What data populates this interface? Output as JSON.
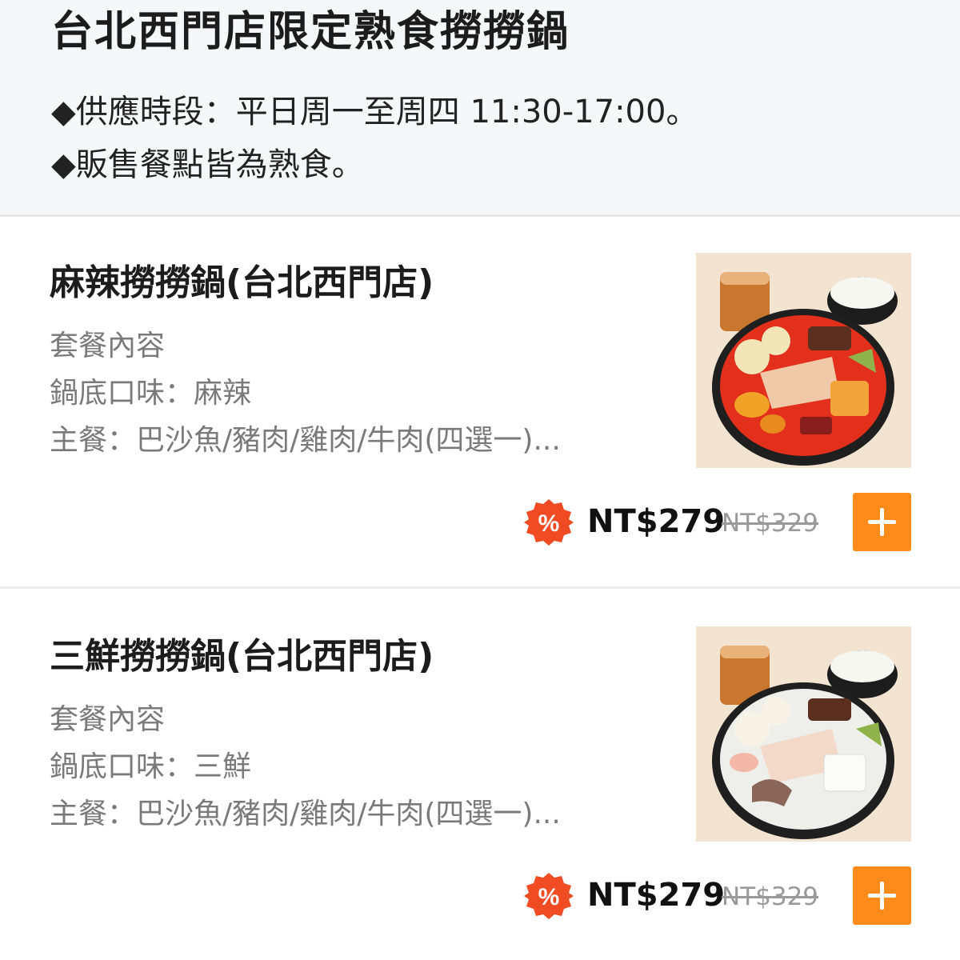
{
  "section": {
    "title": "台北西門店限定熟食撈撈鍋",
    "notices": [
      "◆供應時段：平日周一至周四 11:30-17:00。",
      "◆販售餐點皆為熟食。"
    ]
  },
  "items": [
    {
      "name": "麻辣撈撈鍋(台北西門店)",
      "description": [
        "套餐內容",
        "鍋底口味：麻辣",
        "主餐：巴沙魚/豬肉/雞肉/牛肉(四選一)..."
      ],
      "price": "NT$279",
      "original_price": "NT$329",
      "badge_symbol": "%",
      "add_label": "+",
      "image_icon": "spicy-hotpot-meal-photo"
    },
    {
      "name": "三鮮撈撈鍋(台北西門店)",
      "description": [
        "套餐內容",
        "鍋底口味：三鮮",
        "主餐：巴沙魚/豬肉/雞肉/牛肉(四選一)..."
      ],
      "price": "NT$279",
      "original_price": "NT$329",
      "badge_symbol": "%",
      "add_label": "+",
      "image_icon": "seafood-hotpot-meal-photo"
    }
  ],
  "colors": {
    "accent": "#ff8c1a",
    "discount_badge": "#f04b22",
    "header_bg": "#f6f7f9",
    "muted_text": "#7a7a7a"
  }
}
